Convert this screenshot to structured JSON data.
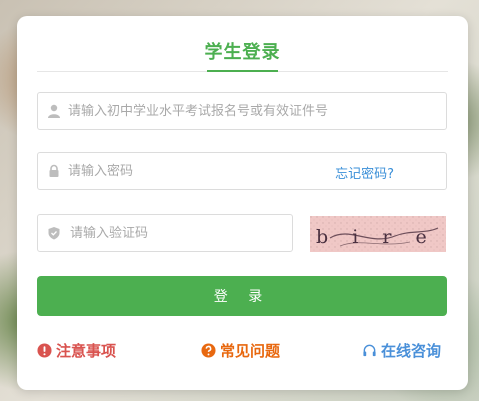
{
  "login": {
    "title": "学生登录",
    "exam_id_placeholder": "请输入初中学业水平考试报名号或有效证件号",
    "password_placeholder": "请输入密码",
    "forgot_password": "忘记密码?",
    "captcha_placeholder": "请输入验证码",
    "captcha_text": "b i r e",
    "login_button": "登 录"
  },
  "links": {
    "notice": "注意事项",
    "faq": "常见问题",
    "consult": "在线咨询"
  },
  "colors": {
    "accent": "#4caf50",
    "notice": "#d9534f",
    "faq": "#e8680f",
    "consult": "#4a90d9"
  }
}
